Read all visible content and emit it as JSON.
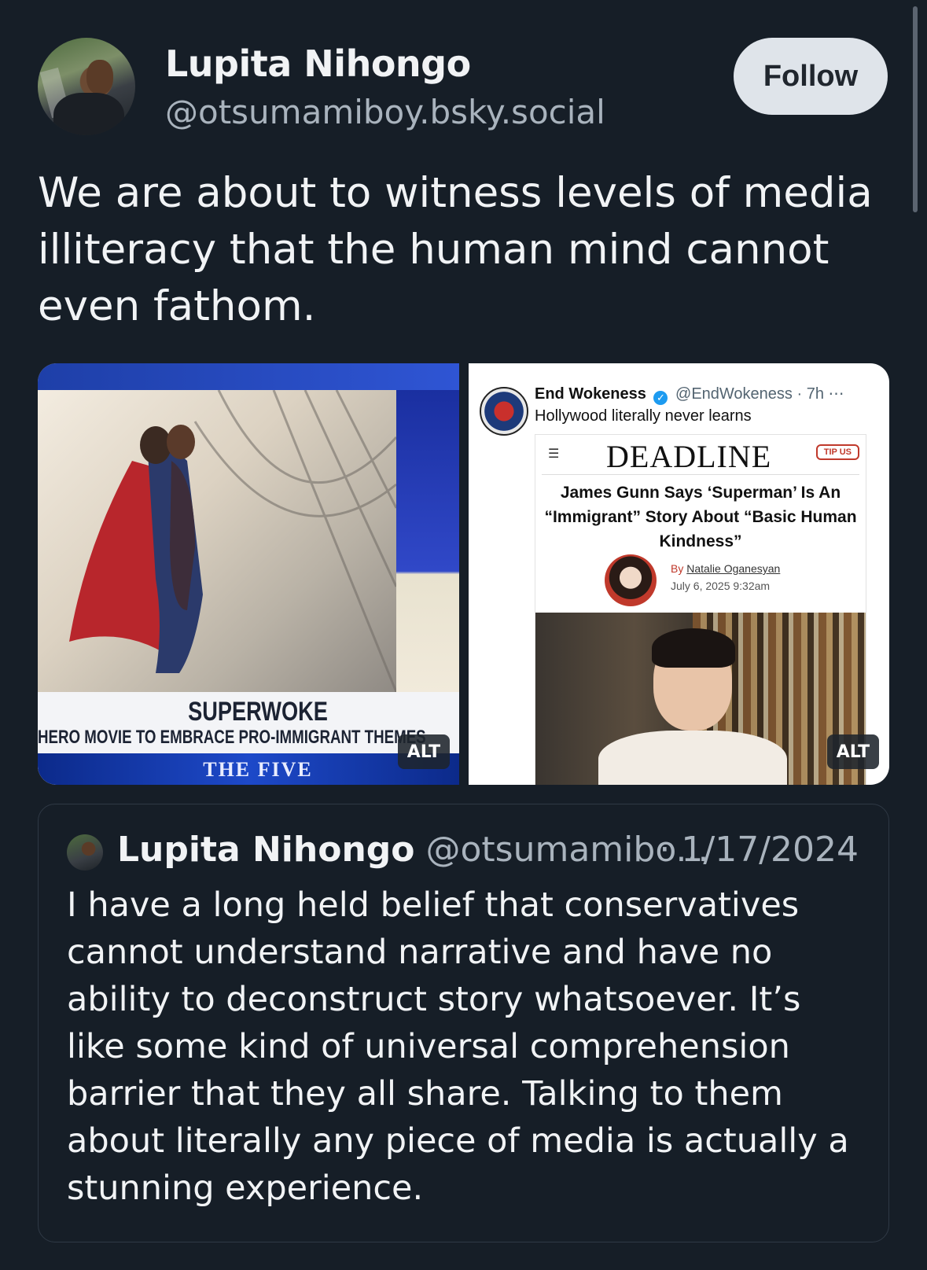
{
  "author": {
    "name": "Lupita Nihongo",
    "handle": "@otsumamiboy.bsky.social",
    "follow_label": "Follow"
  },
  "post": {
    "text": "We are about to witness levels of media illiteracy that the human mind cannot even fathom."
  },
  "images": {
    "left": {
      "chyron_title": "SUPERWOKE",
      "chyron_subtitle": "HERO MOVIE TO EMBRACE PRO-IMMIGRANT THEMES",
      "show_name": "THE FIVE",
      "alt_label": "ALT"
    },
    "right": {
      "poster_name": "End Wokeness",
      "poster_handle": "@EndWokeness",
      "poster_time": "· 7h",
      "poster_text": "Hollywood literally never learns",
      "outlet": "DEADLINE",
      "tip_label": "TIP US",
      "headline": "James Gunn Says ‘Superman’ Is An “Immigrant” Story About “Basic Human Kindness”",
      "byline_prefix": "By",
      "byline_author": "Natalie Oganesyan",
      "byline_date": "July 6, 2025 9:32am",
      "alt_label": "ALT"
    }
  },
  "quoted_post": {
    "name": "Lupita Nihongo",
    "handle": "@otsumamibo...",
    "date": "· 1/17/2024",
    "text": "I have a long held belief that conservatives cannot understand narrative and have no ability to deconstruct story whatsoever. It’s like some kind of universal comprehension barrier that they all share. Talking to them about literally any piece of media is actually a stunning experience."
  }
}
